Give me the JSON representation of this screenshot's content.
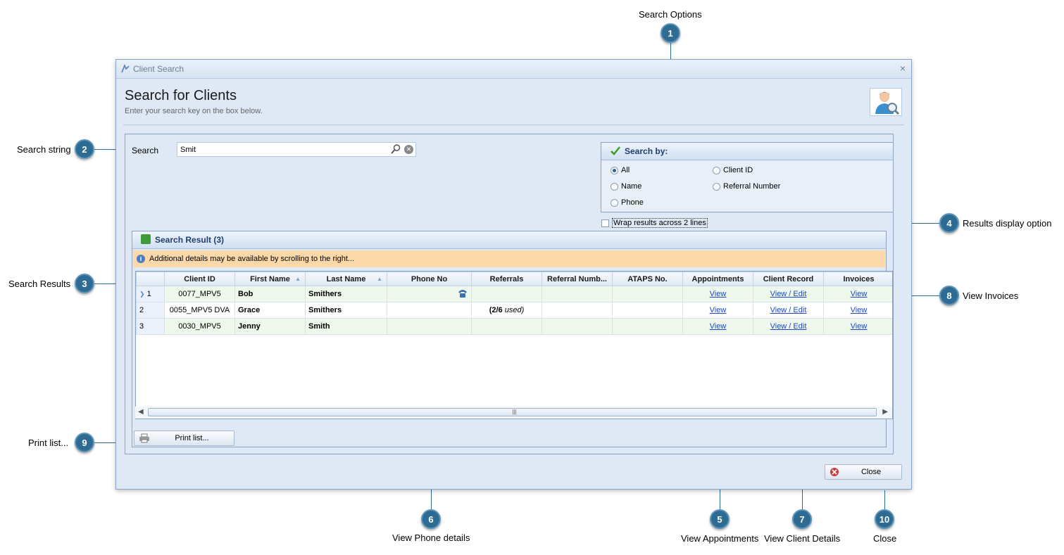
{
  "callouts": {
    "c1": {
      "num": "1",
      "text": "Search Options"
    },
    "c2": {
      "num": "2",
      "text": "Search string"
    },
    "c3": {
      "num": "3",
      "text": "Search Results"
    },
    "c4": {
      "num": "4",
      "text": "Results display option"
    },
    "c5": {
      "num": "5",
      "text": "View Appointments"
    },
    "c6": {
      "num": "6",
      "text": "View Phone details"
    },
    "c7": {
      "num": "7",
      "text": "View Client Details"
    },
    "c8": {
      "num": "8",
      "text": "View Invoices"
    },
    "c9": {
      "num": "9",
      "text": "Print list..."
    },
    "c10": {
      "num": "10",
      "text": "Close"
    }
  },
  "window": {
    "title": "Client Search",
    "close_glyph": "×"
  },
  "header": {
    "title": "Search for Clients",
    "subtitle": "Enter your search key on the box below."
  },
  "search": {
    "label": "Search",
    "value": "Smit"
  },
  "search_by": {
    "title": "Search by:",
    "options": [
      {
        "label": "All",
        "selected": true
      },
      {
        "label": "Client ID",
        "selected": false
      },
      {
        "label": "Name",
        "selected": false
      },
      {
        "label": "Referral Number",
        "selected": false
      },
      {
        "label": "Phone",
        "selected": false
      }
    ]
  },
  "wrap_option": {
    "label": "Wrap results across 2 lines",
    "checked": false
  },
  "results": {
    "title": "Search Result (3)",
    "info": "Additional details may be available by scrolling to the right...",
    "columns": [
      "Client ID",
      "First Name",
      "Last Name",
      "Phone No",
      "Referrals",
      "Referral Numb...",
      "ATAPS No.",
      "Appointments",
      "Client Record",
      "Invoices"
    ],
    "rows": [
      {
        "num": "1",
        "client_id": "0077_MPV5",
        "first": "Bob",
        "last": "Smithers",
        "phone_icon": "phone-icon",
        "referrals_count": "",
        "referrals_suffix": "",
        "referral_number": "",
        "ataps": "",
        "appointments": "View",
        "client_record": "View / Edit",
        "invoices": "View"
      },
      {
        "num": "2",
        "client_id": "0055_MPV5 DVA",
        "first": "Grace",
        "last": "Smithers",
        "phone_icon": "",
        "referrals_count": "(2/6",
        "referrals_suffix": "used)",
        "referral_number": "",
        "ataps": "",
        "appointments": "View",
        "client_record": "View / Edit",
        "invoices": "View"
      },
      {
        "num": "3",
        "client_id": "0030_MPV5",
        "first": "Jenny",
        "last": "Smith",
        "phone_icon": "",
        "referrals_count": "",
        "referrals_suffix": "",
        "referral_number": "",
        "ataps": "",
        "appointments": "View",
        "client_record": "View / Edit",
        "invoices": "View"
      }
    ]
  },
  "buttons": {
    "print": "Print list...",
    "close": "Close"
  },
  "colors": {
    "callout": "#2e6b93",
    "info_bar": "#fdd8a8",
    "link": "#1c48c4"
  }
}
